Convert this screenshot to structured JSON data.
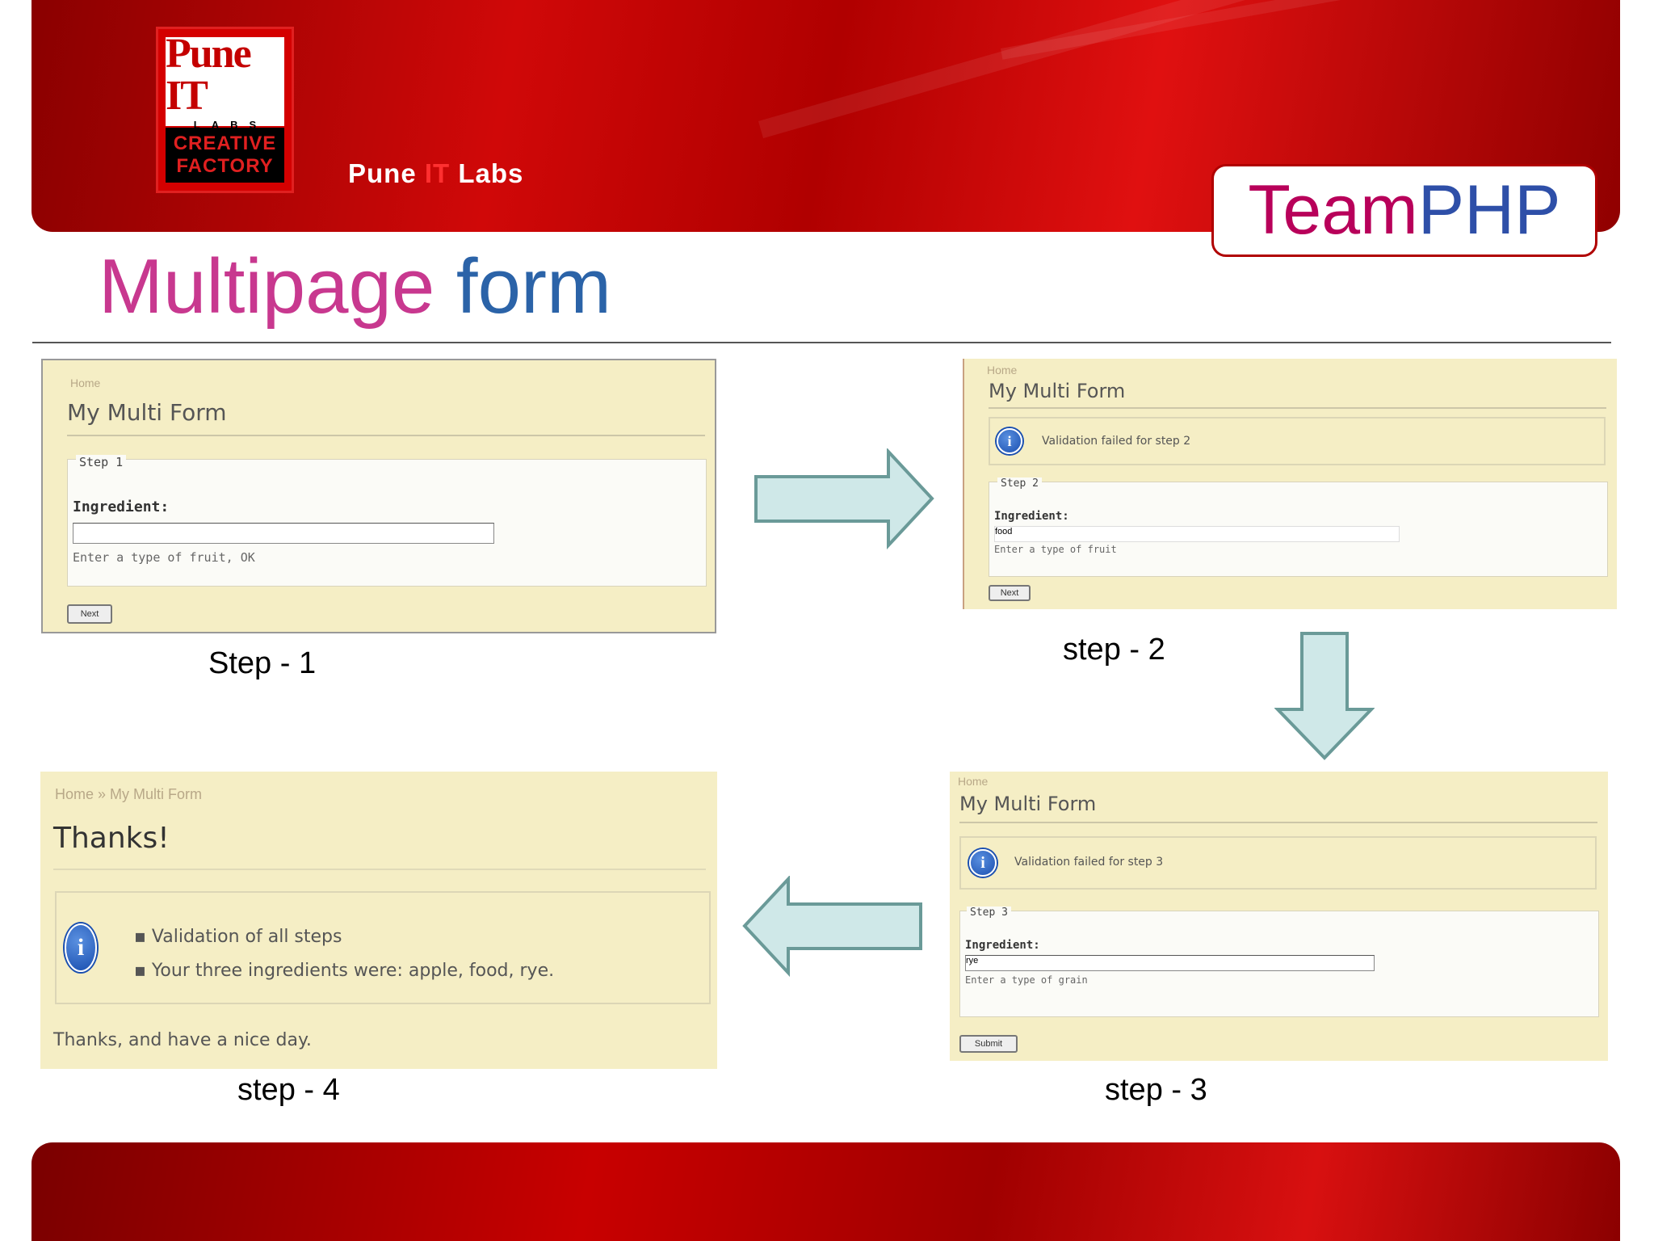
{
  "header": {
    "logo": {
      "name": "Pune IT",
      "sub": "LABS",
      "line1": "CREATIVE",
      "line2": "FACTORY"
    },
    "brand_part1": "Pune",
    "brand_it": "IT",
    "brand_part2": "Labs",
    "team_part1": "Team",
    "team_part2": "PHP"
  },
  "title": {
    "word1": "Multipage",
    "word2": "form"
  },
  "steps": {
    "step1": {
      "caption": "Step - 1",
      "crumb": "Home",
      "form_title": "My Multi Form",
      "step_label": "Step 1",
      "field_label": "Ingredient:",
      "hint": "Enter a type of fruit, OK",
      "button": "Next"
    },
    "step2": {
      "caption": "step - 2",
      "crumb": "Home",
      "form_title": "My Multi Form",
      "message": "Validation failed for step 2",
      "step_label": "Step 2",
      "field_label": "Ingredient:",
      "field_value": "food",
      "hint": "Enter a type of fruit",
      "button": "Next"
    },
    "step3": {
      "caption": "step - 3",
      "crumb": "Home",
      "form_title": "My Multi Form",
      "message": "Validation failed for step 3",
      "step_label": "Step 3",
      "field_label": "Ingredient:",
      "field_value": "rye",
      "hint": "Enter a type of grain",
      "button": "Submit"
    },
    "step4": {
      "caption": "step - 4",
      "crumb": "Home » My Multi Form",
      "form_title": "Thanks!",
      "messages": [
        "Validation of all steps",
        "Your three ingredients were: apple, food, rye."
      ],
      "thanks_text": "Thanks, and have a nice day."
    }
  },
  "colors": {
    "header_red": "#d00808",
    "title_pink": "#c8388f",
    "title_blue": "#2b63a8",
    "arrow_fill": "#cfe8e8",
    "arrow_stroke": "#6a9a98"
  }
}
